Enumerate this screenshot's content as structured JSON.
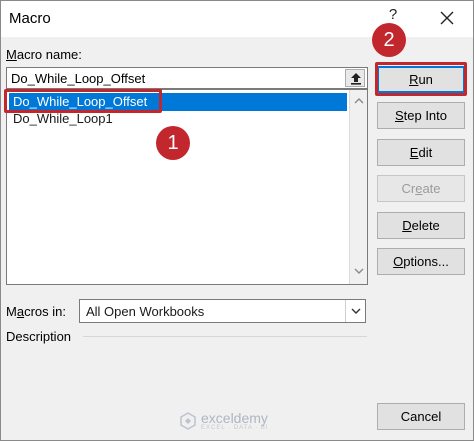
{
  "window": {
    "title": "Macro",
    "help_symbol": "?"
  },
  "macro_name": {
    "label_underlined": "M",
    "label_rest": "acro name:",
    "value": "Do_While_Loop_Offset"
  },
  "macro_list": {
    "items": [
      "Do_While_Loop_Offset",
      "Do_While_Loop1"
    ],
    "selected_index": 0
  },
  "buttons": {
    "run": {
      "underlined": "R",
      "rest": "un"
    },
    "step_into": {
      "underlined": "S",
      "rest": "tep Into"
    },
    "edit": {
      "underlined": "E",
      "rest": "dit"
    },
    "create": {
      "pre": "Cr",
      "underlined": "e",
      "rest": "ate"
    },
    "delete": {
      "underlined": "D",
      "rest": "elete"
    },
    "options": {
      "underlined": "O",
      "rest": "ptions..."
    },
    "cancel": {
      "label": "Cancel"
    }
  },
  "macros_in": {
    "label_pre": "M",
    "label_underlined": "a",
    "label_rest": "cros in:",
    "selected": "All Open Workbooks"
  },
  "description": {
    "label": "Description"
  },
  "annotations": {
    "badge1": "1",
    "badge2": "2",
    "accent_color": "#c1272d"
  },
  "watermark": {
    "name": "exceldemy",
    "tagline": "EXCEL · DATA · BI"
  }
}
